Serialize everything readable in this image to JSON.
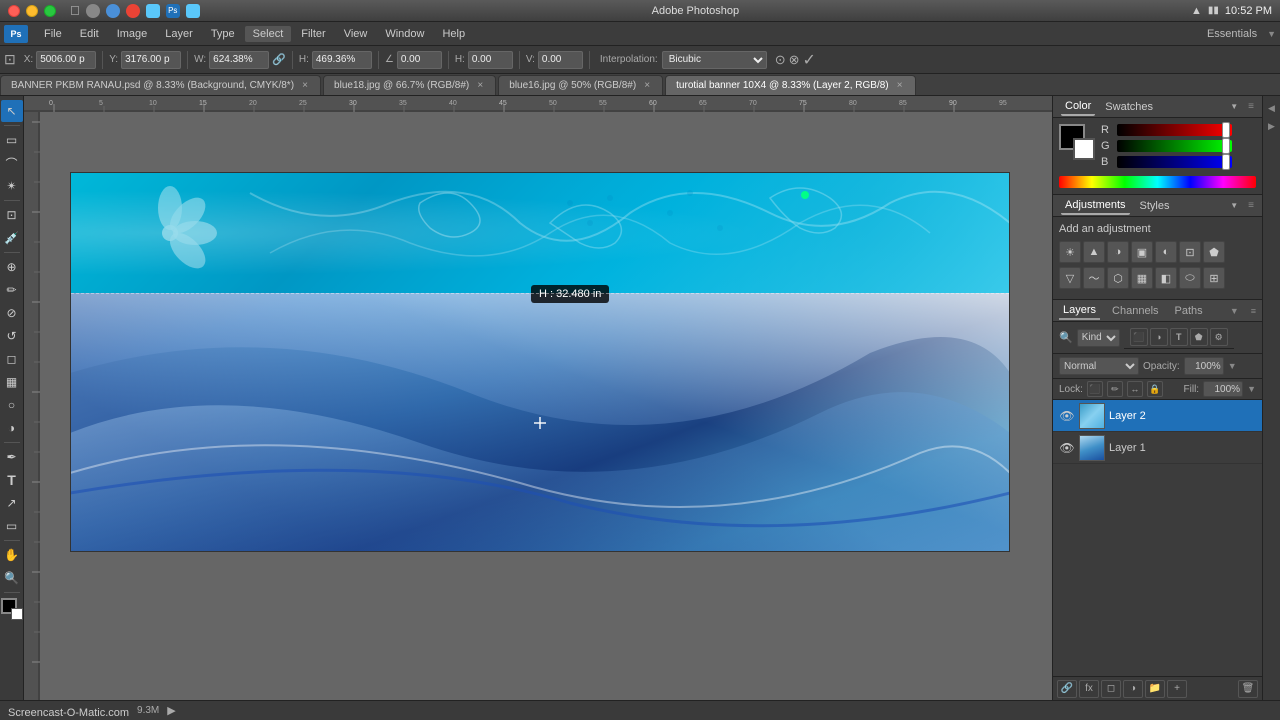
{
  "app": {
    "name": "Adobe Photoshop",
    "logo": "Ps"
  },
  "titlebar": {
    "mac_icons": [
      "close",
      "minimize",
      "maximize"
    ],
    "time": "10:52 PM",
    "wifi_icon": "wifi",
    "battery_icon": "battery"
  },
  "menubar": {
    "items": [
      "File",
      "Edit",
      "Image",
      "Layer",
      "Type",
      "Select",
      "Filter",
      "View",
      "Window",
      "Help"
    ]
  },
  "optionsbar": {
    "x_label": "X:",
    "x_value": "5006.00 p",
    "y_label": "Y:",
    "y_value": "3176.00 p",
    "w_label": "W:",
    "w_value": "624.38%",
    "link_icon": "link",
    "h_label": "H:",
    "h_value": "469.36%",
    "angle_label": "∠",
    "angle_value": "0.00",
    "h2_label": "H:",
    "h2_value": "0.00",
    "v_label": "V:",
    "v_value": "0.00",
    "interpolation_label": "Interpolation:",
    "interpolation_value": "Bicubic",
    "cancel_label": "✕",
    "apply_label": "✓",
    "essentials": "Essentials"
  },
  "tabs": [
    {
      "id": "tab1",
      "label": "BANNER PKBM RANAU.psd @ 8.33% (Background, CMYK/8*)",
      "active": false
    },
    {
      "id": "tab2",
      "label": "blue18.jpg @ 66.7% (RGB/8#)",
      "active": false
    },
    {
      "id": "tab3",
      "label": "blue16.jpg @ 50% (RGB/8#)",
      "active": false
    },
    {
      "id": "tab4",
      "label": "turotial banner 10X4 @ 8.33% (Layer 2, RGB/8)",
      "active": true
    }
  ],
  "canvas": {
    "zoom": "8.33%",
    "dimension_tooltip": "H : 32.480 in"
  },
  "colorpanel": {
    "tab_color": "Color",
    "tab_swatches": "Swatches",
    "r_value": "",
    "g_value": "",
    "b_value": ""
  },
  "adjustments": {
    "title": "Add an adjustment",
    "icons": [
      "☀",
      "▲",
      "◑",
      "▣",
      "◐",
      "⊡",
      "⬟",
      "▽",
      "〜",
      "⬡",
      "▦",
      "◧",
      "⬭",
      "⊞"
    ]
  },
  "layers": {
    "tab_layers": "Layers",
    "tab_channels": "Channels",
    "tab_paths": "Paths",
    "search_placeholder": "Kind",
    "blend_mode": "Normal",
    "opacity_value": "100%",
    "lock_label": "Lock:",
    "fill_label": "Fill:",
    "fill_value": "100%",
    "items": [
      {
        "id": "layer2",
        "name": "Layer 2",
        "visible": true,
        "active": true
      },
      {
        "id": "layer1",
        "name": "Layer 1",
        "visible": true,
        "active": false
      }
    ]
  },
  "statusbar": {
    "watermark": "Screencast-O-Matic.com",
    "file_size": "9.3M",
    "play_icon": "▶"
  }
}
